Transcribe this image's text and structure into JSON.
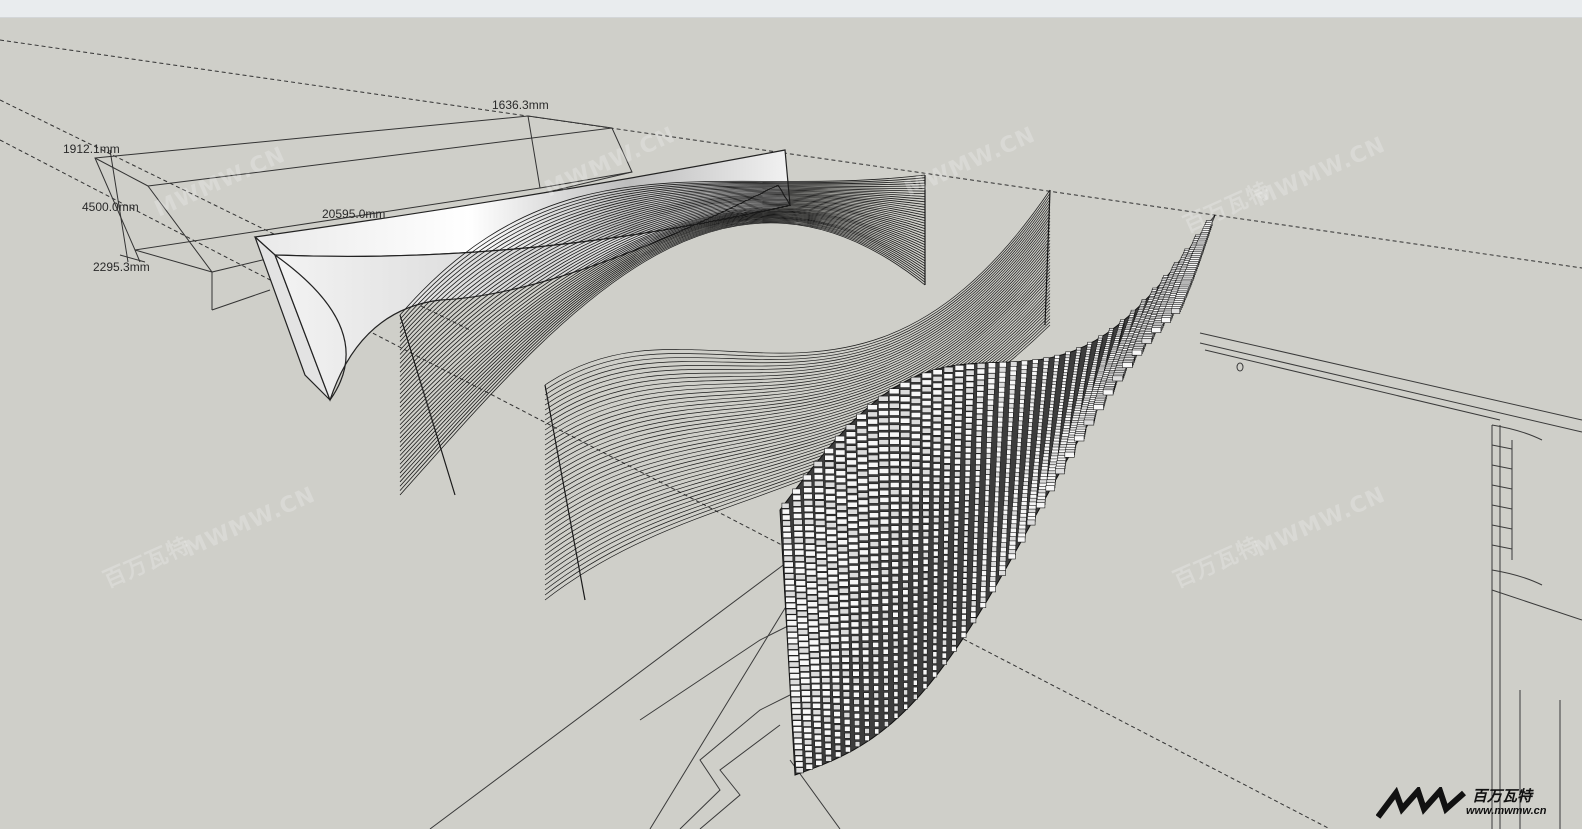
{
  "dimensions": {
    "d1": "1636.3mm",
    "d2": "1912.1mm",
    "d3": "4500.0mm",
    "d4": "20595.0mm",
    "d5": "2295.3mm"
  },
  "watermarks": [
    "MWMW.CN",
    "MWMW.CN",
    "MWMW.CN",
    "百万瓦特",
    "MWMW.CN",
    "百万瓦特",
    "MWMW.CN",
    "百万瓦特",
    "MWMW.CN"
  ],
  "logo": {
    "cn": "百万瓦特",
    "url": "www.mwmw.cn"
  },
  "colors": {
    "background": "#cfcfc9",
    "edge": "#222222",
    "face": "#f4f4f4"
  }
}
